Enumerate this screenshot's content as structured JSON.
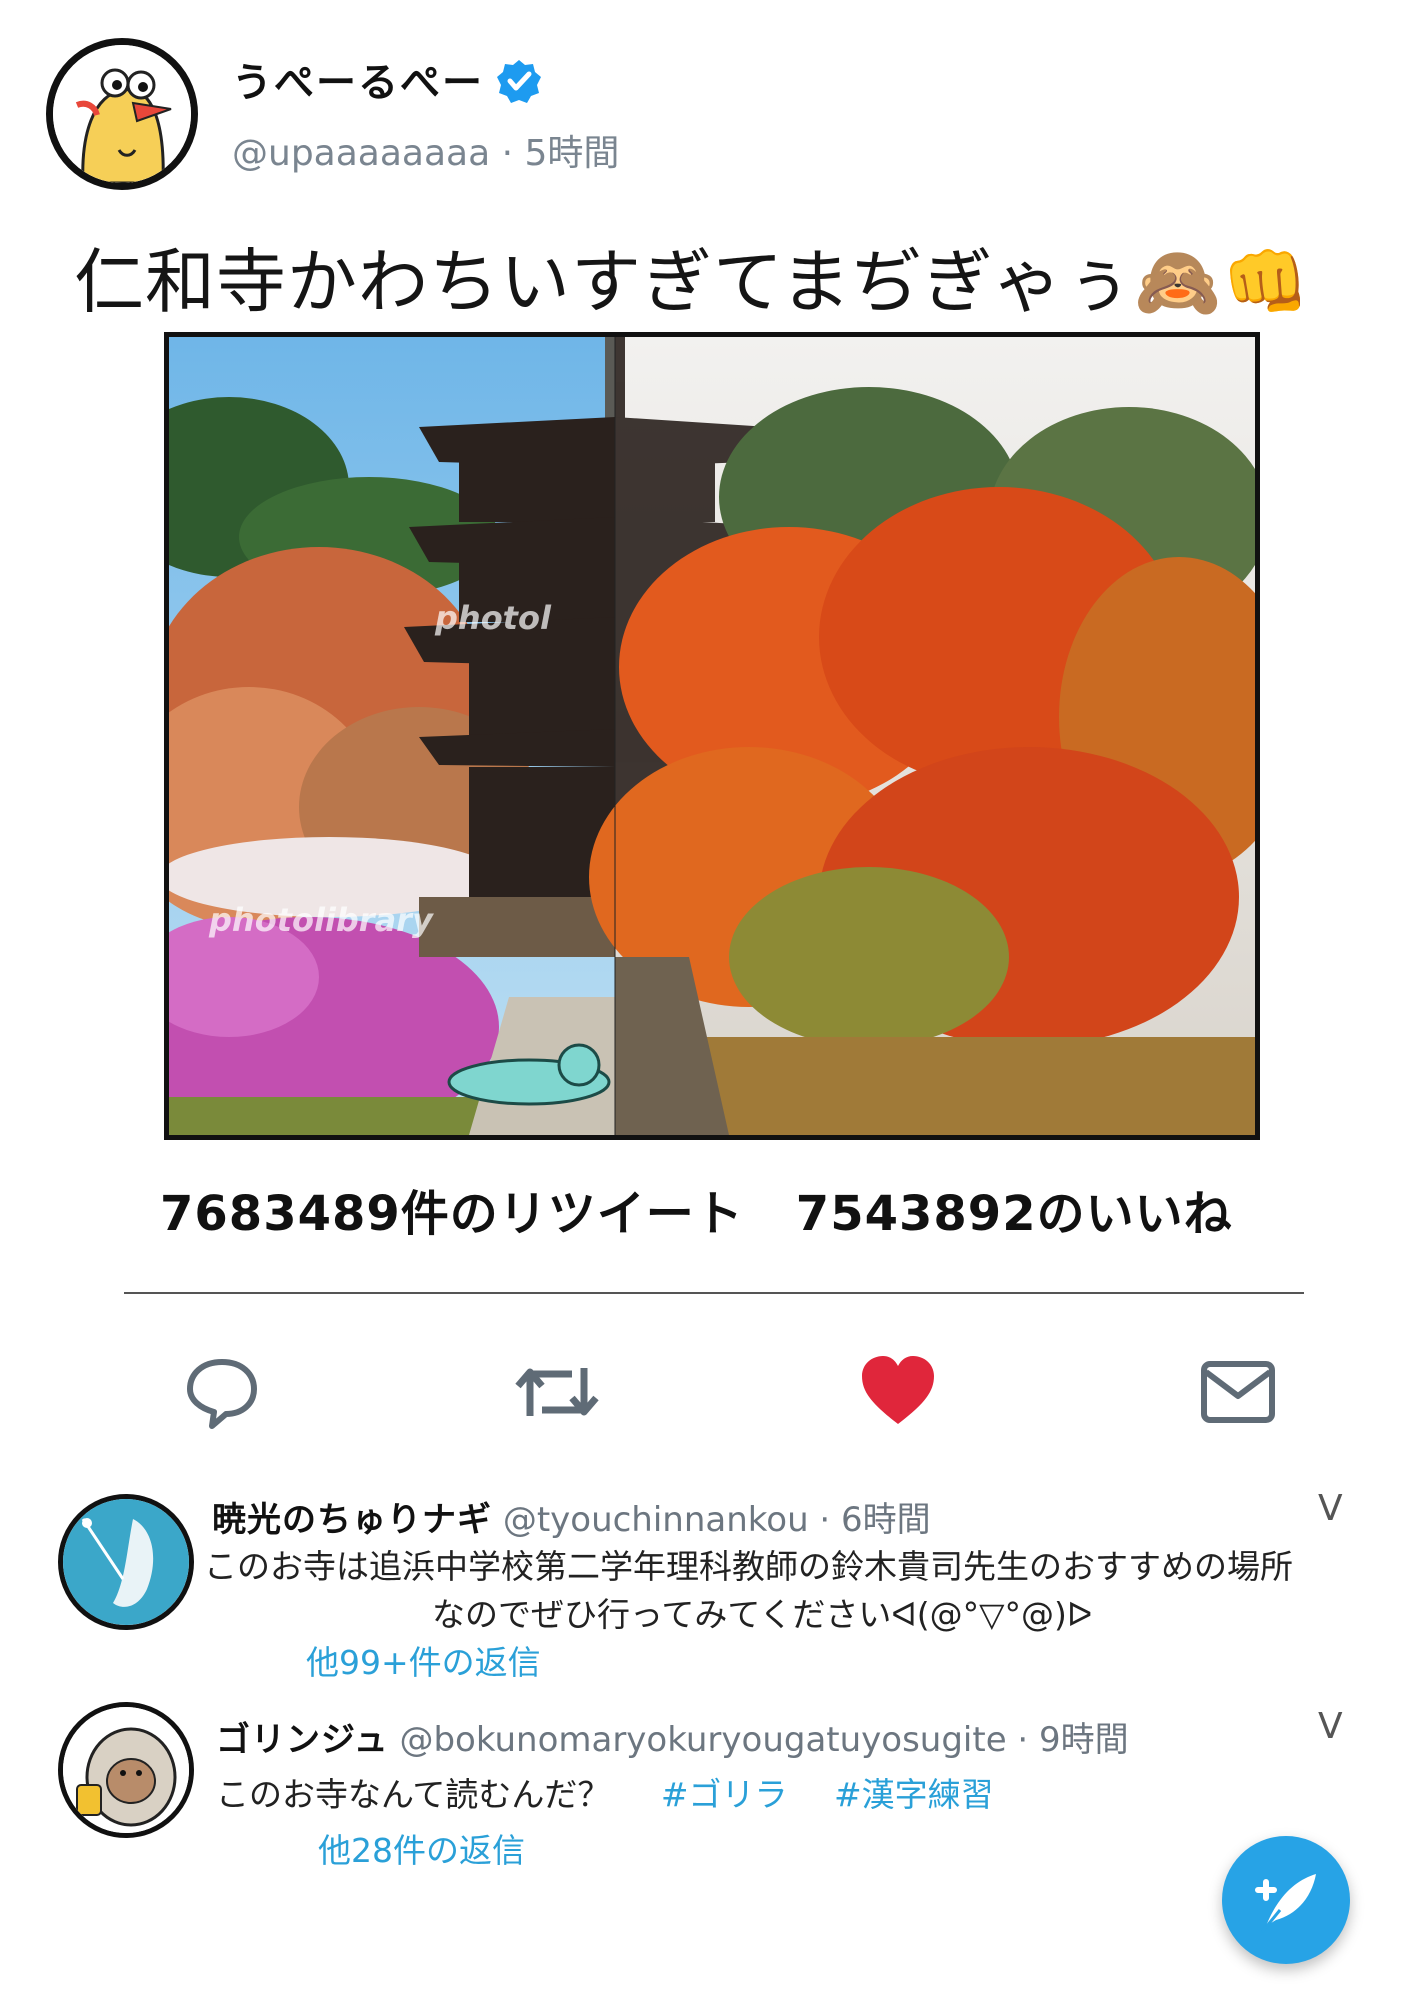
{
  "tweet": {
    "display_name": "うぺーるぺー",
    "handle_line": "@upaaaaaaaa · 5時間",
    "text": "仁和寺かわちいすぎてまぢぎゃぅ🙈👊",
    "retweets_text": "7683489件のリツイート",
    "likes_text": "7543892のいいね",
    "photo_watermark_1": "photol",
    "photo_watermark_2": "photolibrary"
  },
  "actions": [
    {
      "name": "reply",
      "icon": "speech-bubble-icon"
    },
    {
      "name": "retweet",
      "icon": "retweet-icon"
    },
    {
      "name": "like",
      "icon": "heart-icon",
      "color": "#e0263b"
    },
    {
      "name": "message",
      "icon": "envelope-icon"
    }
  ],
  "replies": [
    {
      "name": "暁光のちゅりナギ",
      "handle_time": "@tyouchinnankou · 6時間",
      "chevron": "V",
      "body_line1": "このお寺は追浜中学校第二学年理科教師の鈴木貴司先生のおすすめの場所",
      "body_line2": "なのでぜひ行ってみてくださいᐊ(@°▽°@)ᐅ",
      "more": "他99+件の返信"
    },
    {
      "name": "ゴリンジュ",
      "handle_time": "@bokunomaryokuryougatuyosugite · 9時間",
      "chevron": "V",
      "body": "このお寺なんて読むんだ？",
      "tag1": "#ゴリラ",
      "tag2": "#漢字練習",
      "more": "他28件の返信"
    }
  ],
  "colors": {
    "accent": "#27a3e6",
    "link": "#2aa0d8",
    "like": "#e0263b",
    "verified": "#1d9bf0"
  }
}
